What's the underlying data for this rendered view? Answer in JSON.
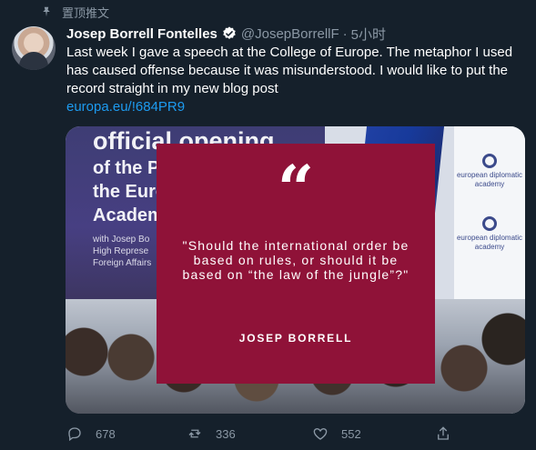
{
  "pinned_label": "置顶推文",
  "author": {
    "name": "Josep Borrell Fontelles",
    "handle": "@JosepBorrellF",
    "separator": "·",
    "time": "5小时"
  },
  "tweet": {
    "text": "Last week I gave a speech at the College of Europe. The metaphor I used has caused offense because it was misunderstood. I would like to put the record straight in my new blog post",
    "link": "europa.eu/!684PR9"
  },
  "media": {
    "slide_line1": "official opening",
    "slide_line2": "of the Pilot Programme of",
    "slide_line3": "the Euro",
    "slide_line4": "Academ",
    "slide_small1": "with Josep Bo",
    "slide_small2": "High Represe",
    "slide_small3": "Foreign Affairs",
    "logo_text1": "european diplomatic",
    "logo_text2": "academy",
    "quote_mark": "“",
    "quote_text": "\"Should the international order be based on rules, or should it be based on “the law of the jungle”?\"",
    "quote_author": "JOSEP BORRELL",
    "card_color": "#8f1238"
  },
  "actions": {
    "replies": "678",
    "retweets": "336",
    "likes": "552"
  },
  "colors": {
    "background": "#15202b",
    "secondary_text": "#8b98a5",
    "link": "#1d9bf0"
  }
}
